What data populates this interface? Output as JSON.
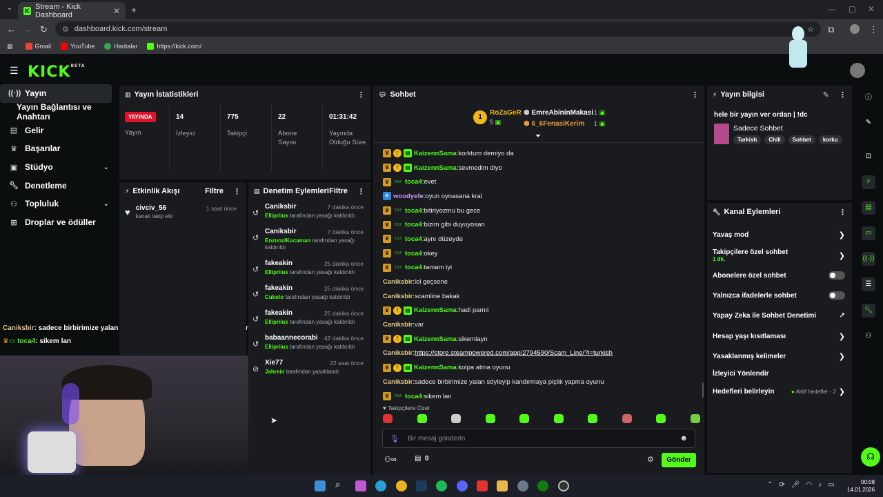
{
  "browser": {
    "tab_title": "Stream - Kick Dashboard",
    "url": "dashboard.kick.com/stream",
    "bookmarks": [
      "Gmail",
      "YouTube",
      "Haritalar",
      "https://kick.com/"
    ]
  },
  "brand": {
    "logo": "KICK",
    "beta": "BETA"
  },
  "sidebar": {
    "items": [
      {
        "label": "Yayın",
        "icon": "broadcast-icon"
      },
      {
        "label": "Yayın Bağlantısı ve Anahtarı",
        "icon": ""
      },
      {
        "label": "Gelir",
        "icon": "wallet-icon"
      },
      {
        "label": "Başarılar",
        "icon": "trophy-icon"
      },
      {
        "label": "Stüdyo",
        "icon": "studio-icon"
      },
      {
        "label": "Denetleme",
        "icon": "wrench-icon"
      },
      {
        "label": "Topluluk",
        "icon": "community-icon"
      },
      {
        "label": "Droplar ve ödüller",
        "icon": "gift-icon"
      }
    ]
  },
  "stats": {
    "title": "Yayın İstatistikleri",
    "live_badge": "YAYINDA",
    "live_label": "Yayın",
    "viewers": {
      "value": "14",
      "label": "İzleyici"
    },
    "followers": {
      "value": "775",
      "label": "Takipçi"
    },
    "subs": {
      "value": "22",
      "label": "Abone Sayısı"
    },
    "uptime": {
      "value": "01:31:42",
      "label": "Yayında Olduğu Süre"
    }
  },
  "activity": {
    "title": "Etkinlik Akışı",
    "filter": "Filtre",
    "items": [
      {
        "user": "civciv_56",
        "desc": "kanalı takip etti",
        "time": "1 saat önce"
      }
    ]
  },
  "moderation": {
    "title": "Denetim Eylemleri",
    "filter": "Filtre",
    "items": [
      {
        "user": "Caniksbir",
        "time": "7 dakika önce",
        "actor": "Ellipriius",
        "desc": "tarafından yasağı kaldırıldı"
      },
      {
        "user": "Caniksbir",
        "time": "7 dakika önce",
        "actor": "EnzonziKocaman",
        "desc": "tarafından yasağı kaldırıldı"
      },
      {
        "user": "fakeakin",
        "time": "25 dakika önce",
        "actor": "Ellipriius",
        "desc": "tarafından yasağı kaldırıldı"
      },
      {
        "user": "fakeakin",
        "time": "25 dakika önce",
        "actor": "Cubelo",
        "desc": "tarafından yasağı kaldırıldı"
      },
      {
        "user": "fakeakin",
        "time": "25 dakika önce",
        "actor": "Ellipriius",
        "desc": "tarafından yasağı kaldırıldı"
      },
      {
        "user": "babaannecorabi",
        "time": "42 dakika önce",
        "actor": "Ellipriius",
        "desc": "tarafından yasağı kaldırıldı"
      },
      {
        "user": "Xie77",
        "time": "22 saat önce",
        "actor": "Jahrein",
        "desc": "tarafından yasaklandı"
      }
    ]
  },
  "chat": {
    "title": "Sohbet",
    "top_gifter": {
      "name": "RoZaGeR",
      "count": "5"
    },
    "gifter2": {
      "name": "EmreAbininMakasi",
      "count": "1"
    },
    "gifter3": {
      "name": "6_6FenasiKerim",
      "count": "1"
    },
    "messages": [
      {
        "user": "KaizennSama",
        "text": "korktum demiyo da",
        "style": "green",
        "badges": "crown,sub,mod"
      },
      {
        "user": "KaizennSama",
        "text": "sevmedim diyo",
        "style": "green",
        "badges": "crown,sub,mod"
      },
      {
        "user": "toca4",
        "text": "evet",
        "style": "green",
        "badges": "crown,og"
      },
      {
        "user": "woodyefe",
        "text": "oyun oynasana kral",
        "style": "pink",
        "badges": "vip"
      },
      {
        "user": "toca4",
        "text": "bitiriyozmu bu gece",
        "style": "green",
        "badges": "crown,og"
      },
      {
        "user": "toca4",
        "text": "bizim gibi duyuyosan",
        "style": "green",
        "badges": "crown,og"
      },
      {
        "user": "toca4",
        "text": "aynı düzeyde",
        "style": "green",
        "badges": "crown,og"
      },
      {
        "user": "toca4",
        "text": "okey",
        "style": "green",
        "badges": "crown,og"
      },
      {
        "user": "toca4",
        "text": "tamam iyi",
        "style": "green",
        "badges": "crown,og"
      },
      {
        "user": "Caniksbir",
        "text": "lol geçsene",
        "style": "tan",
        "badges": ""
      },
      {
        "user": "Caniksbir",
        "text": "scamline bakak",
        "style": "tan",
        "badges": ""
      },
      {
        "user": "KaizennSama",
        "text": "hadi pamıl",
        "style": "green",
        "badges": "crown,sub,mod"
      },
      {
        "user": "Caniksbir",
        "text": "var",
        "style": "tan",
        "badges": ""
      },
      {
        "user": "KaizennSama",
        "text": "sikemlayn",
        "style": "green",
        "badges": "crown,sub,mod"
      },
      {
        "user": "Caniksbir",
        "text": "https://store.steampowered.com/app/2794590/Scam_Line/?l=turkish",
        "style": "tan",
        "badges": "",
        "link": true
      },
      {
        "user": "KaizennSama",
        "text": "kolpa atma oyunu",
        "style": "green",
        "badges": "crown,sub,mod"
      },
      {
        "user": "Caniksbir",
        "text": "sadece birbirimize yalan söyleyip kandırmaya piçlik yapma oyunu",
        "style": "tan",
        "badges": ""
      },
      {
        "user": "toca4",
        "text": "sikem lan",
        "style": "green",
        "badges": "crown,og"
      }
    ],
    "follower_only": "Takipçilere Özel",
    "input_placeholder": "Bir mesaj gönderin",
    "points": "0",
    "send": "Gönder"
  },
  "stream_info": {
    "title": "Yayın bilgisi",
    "stream_title": "hele bir yayın ver ordan | !dc",
    "category": "Sadece Sohbet",
    "tags": [
      "Turkish",
      "Chill",
      "Sohbet",
      "korku"
    ]
  },
  "channel_actions": {
    "title": "Kanal Eylemleri",
    "slow_mode": "Yavaş mod",
    "follower_chat": "Takipçilere özel sohbet",
    "follower_chat_value": "1 dk.",
    "sub_chat": "Abonelere özel sohbet",
    "emote_chat": "Yalnızca ifadelerle sohbet",
    "ai_mod": "Yapay Zeka ile Sohbet Denetimi",
    "account_age": "Hesap yaşı kısıtlaması",
    "banned_words": "Yasaklanmış kelimeler",
    "raid": "İzleyici Yönlendir",
    "goals": "Hedefleri belirleyin",
    "goals_status": "Aktif hedefler - 2"
  },
  "overlay": {
    "line1_user": "Caniksbir",
    "line1_text": ": sadece birbirimize yalan söyleyip kandırmaya piçlik yapma oyunu",
    "line2_user": "toca4",
    "line2_text": ": sikem lan"
  },
  "taskbar": {
    "time": "00:08",
    "date": "14.01.2026"
  }
}
